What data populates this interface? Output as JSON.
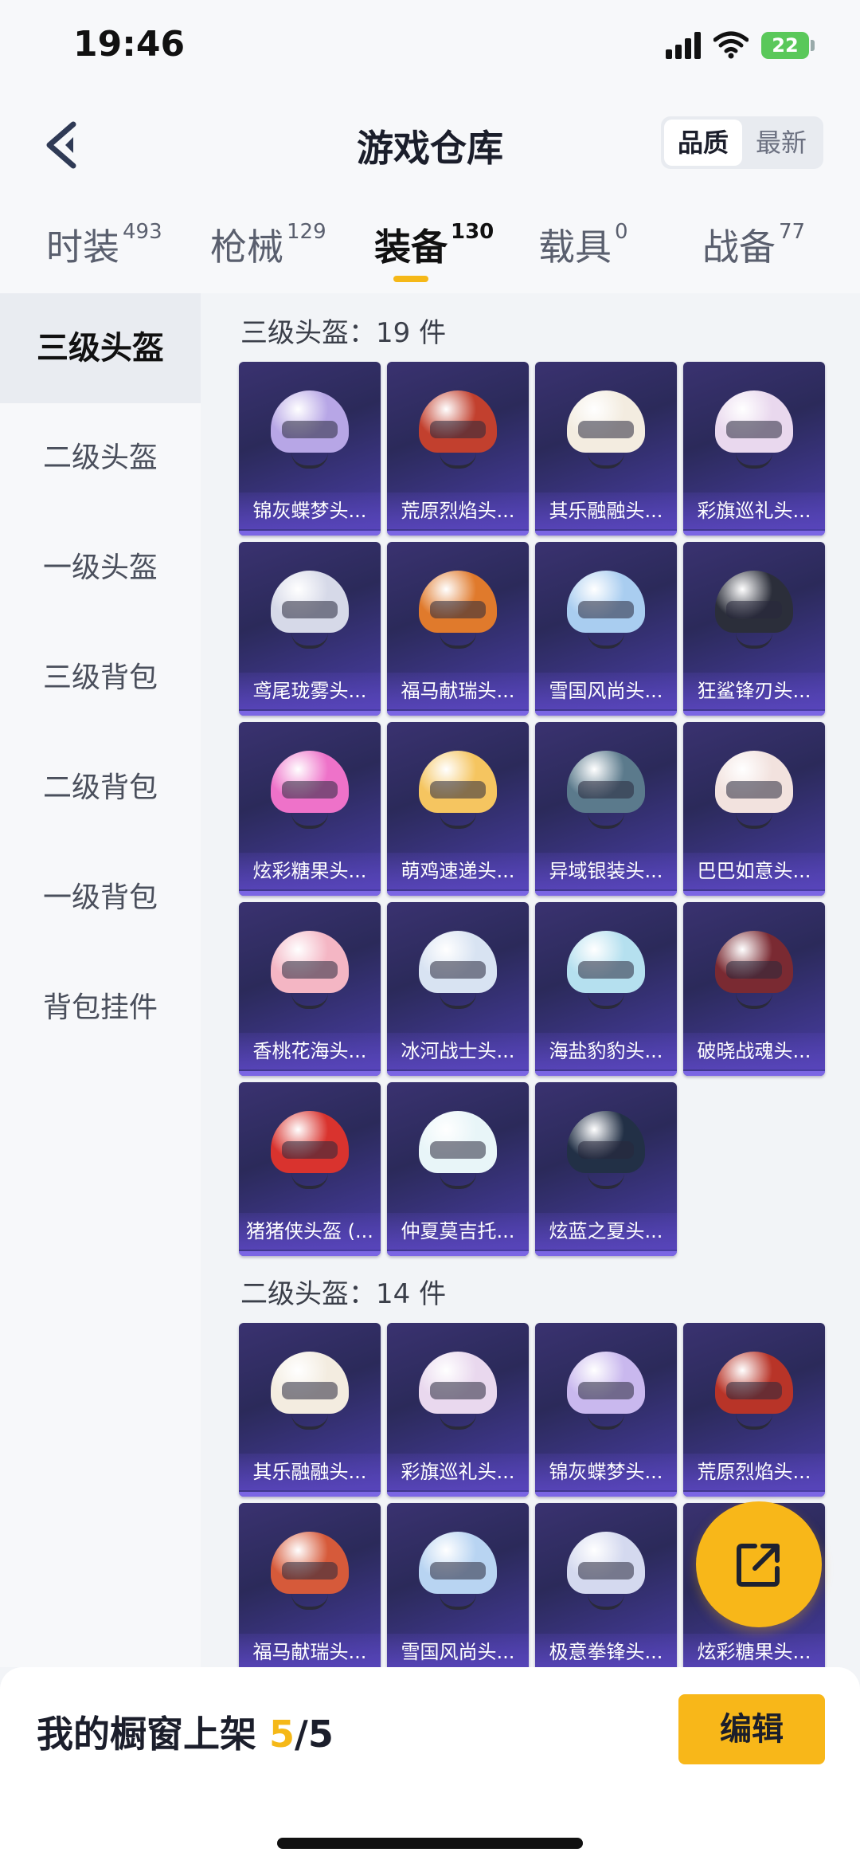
{
  "status_bar": {
    "time": "19:46",
    "battery": "22"
  },
  "header": {
    "title": "游戏仓库",
    "sort_options": [
      "品质",
      "最新"
    ]
  },
  "tabs": [
    {
      "label": "时装",
      "count": "493"
    },
    {
      "label": "枪械",
      "count": "129"
    },
    {
      "label": "装备",
      "count": "130"
    },
    {
      "label": "载具",
      "count": "0"
    },
    {
      "label": "战备",
      "count": "77"
    }
  ],
  "sidebar": {
    "items": [
      "三级头盔",
      "二级头盔",
      "一级头盔",
      "三级背包",
      "二级背包",
      "一级背包",
      "背包挂件"
    ]
  },
  "sections": [
    {
      "title": "三级头盔：19 件",
      "items": [
        {
          "name": "锦灰蝶梦头...",
          "color": "#b7a6e6"
        },
        {
          "name": "荒原烈焰头...",
          "color": "#c2402e"
        },
        {
          "name": "其乐融融头...",
          "color": "#f3ece0"
        },
        {
          "name": "彩旗巡礼头...",
          "color": "#e9d8ee"
        },
        {
          "name": "鸢尾珑雾头...",
          "color": "#d6d9e8"
        },
        {
          "name": "福马献瑞头...",
          "color": "#e07a2c"
        },
        {
          "name": "雪国风尚头...",
          "color": "#a9cdf0"
        },
        {
          "name": "狂鲨锋刃头...",
          "color": "#2b2e3a"
        },
        {
          "name": "炫彩糖果头...",
          "color": "#ee72c9"
        },
        {
          "name": "萌鸡速递头...",
          "color": "#f5c560"
        },
        {
          "name": "异域银装头...",
          "color": "#5b7a8c"
        },
        {
          "name": "巴巴如意头...",
          "color": "#f2e2de"
        },
        {
          "name": "香桃花海头...",
          "color": "#f4b6c4"
        },
        {
          "name": "冰河战士头...",
          "color": "#d8e3f2"
        },
        {
          "name": "海盐豹豹头...",
          "color": "#b5e0ef"
        },
        {
          "name": "破晓战魂头...",
          "color": "#7a2a32"
        },
        {
          "name": "猪猪侠头盔 (...",
          "color": "#d9332e"
        },
        {
          "name": "仲夏莫吉托...",
          "color": "#e8f5f8"
        },
        {
          "name": "炫蓝之夏头...",
          "color": "#223046"
        }
      ]
    },
    {
      "title": "二级头盔：14 件",
      "items": [
        {
          "name": "其乐融融头...",
          "color": "#f3ece0"
        },
        {
          "name": "彩旗巡礼头...",
          "color": "#e9d8ee"
        },
        {
          "name": "锦灰蝶梦头...",
          "color": "#c9b8ee"
        },
        {
          "name": "荒原烈焰头...",
          "color": "#b83428"
        },
        {
          "name": "福马献瑞头...",
          "color": "#d65a3a"
        },
        {
          "name": "雪国风尚头...",
          "color": "#b8d4f2"
        },
        {
          "name": "极意拳锋头...",
          "color": "#d4d9ef"
        },
        {
          "name": "炫彩糖果头...",
          "color": "#ee72c9"
        }
      ]
    }
  ],
  "bottom_bar": {
    "showcase_label": "我的橱窗上架",
    "showcase_count": "5",
    "showcase_total": "/5",
    "edit_label": "编辑"
  },
  "colors": {
    "accent": "#f8b719",
    "card_top": "#3a3270",
    "card_bottom": "#4a3ea8"
  }
}
